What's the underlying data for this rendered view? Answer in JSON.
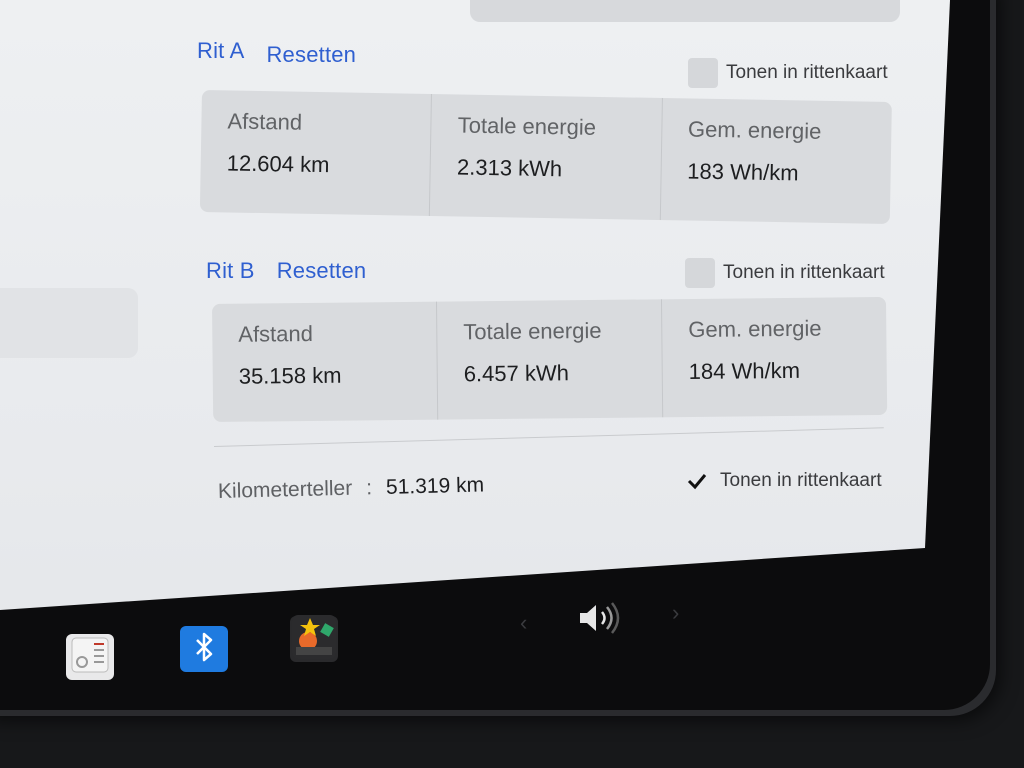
{
  "trips": [
    {
      "title": "Rit A",
      "reset_label": "Resetten",
      "show_map_label": "Tonen in rittenkaart",
      "show_map_checked": false,
      "stats": {
        "distance_label": "Afstand",
        "distance_value": "12.604  km",
        "energy_label": "Totale energie",
        "energy_value": "2.313  kWh",
        "avg_label": "Gem. energie",
        "avg_value": "183  Wh/km"
      }
    },
    {
      "title": "Rit B",
      "reset_label": "Resetten",
      "show_map_label": "Tonen in rittenkaart",
      "show_map_checked": false,
      "stats": {
        "distance_label": "Afstand",
        "distance_value": "35.158  km",
        "energy_label": "Totale energie",
        "energy_value": "6.457  kWh",
        "avg_label": "Gem. energie",
        "avg_value": "184  Wh/km"
      }
    }
  ],
  "odometer": {
    "label": "Kilometerteller",
    "separator": ":",
    "value": "51.319  km",
    "show_map_label": "Tonen in rittenkaart",
    "show_map_checked": true
  },
  "taskbar": {
    "apps": [
      {
        "icon": "notes-app-icon"
      },
      {
        "icon": "bluetooth-icon"
      },
      {
        "icon": "arcade-icon"
      }
    ],
    "volume_prev": "‹",
    "volume_next": "›",
    "volume_icon": "speaker-icon"
  },
  "colors": {
    "accent": "#2f5fd0",
    "bluetooth": "#1f7be0"
  }
}
